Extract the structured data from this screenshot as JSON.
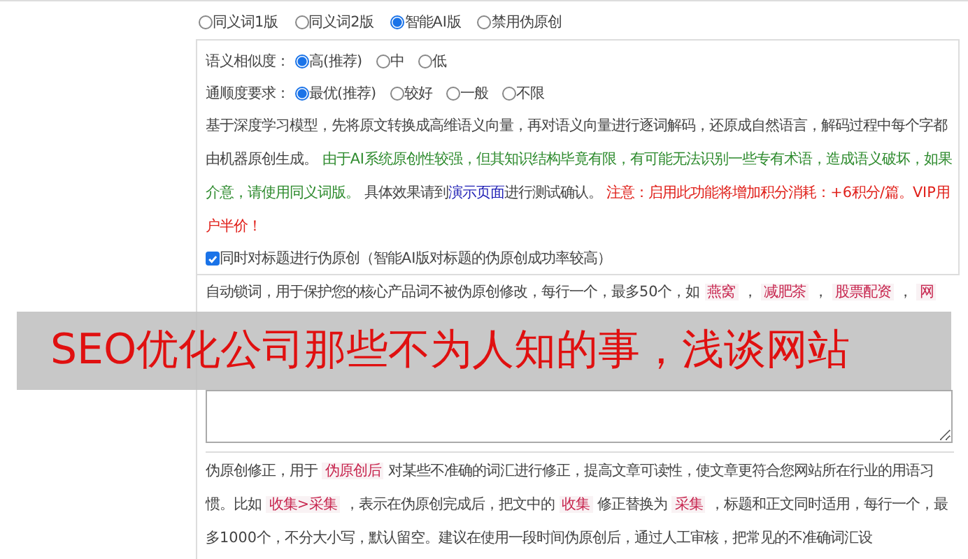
{
  "mode_options": [
    {
      "label": "同义词1版",
      "selected": false
    },
    {
      "label": "同义词2版",
      "selected": false
    },
    {
      "label": "智能AI版",
      "selected": true
    },
    {
      "label": "禁用伪原创",
      "selected": false
    }
  ],
  "similarity": {
    "label": "语义相似度：",
    "options": [
      {
        "label": "高(推荐)",
        "selected": true
      },
      {
        "label": "中",
        "selected": false
      },
      {
        "label": "低",
        "selected": false
      }
    ]
  },
  "fluency": {
    "label": "通顺度要求：",
    "options": [
      {
        "label": "最优(推荐)",
        "selected": true
      },
      {
        "label": "较好",
        "selected": false
      },
      {
        "label": "一般",
        "selected": false
      },
      {
        "label": "不限",
        "selected": false
      }
    ]
  },
  "description": [
    {
      "kind": "plain",
      "text": "基于深度学习模型，先将原文转换成高维语义向量，再对语义向量进行逐词解码，还原成自然语言，解码过程中每个字都由机器原创生成。 "
    },
    {
      "kind": "green",
      "text": "由于AI系统原创性较强，但其知识结构毕竟有限，有可能无法识别一些专有术语，造成语义破坏，如果介意，请使用同义词版。"
    },
    {
      "kind": "plain",
      "text": " 具体效果请到"
    },
    {
      "kind": "link",
      "text": "演示页面"
    },
    {
      "kind": "plain",
      "text": "进行测试确认。 "
    },
    {
      "kind": "red",
      "text": "注意：启用此功能将增加积分消耗：+6积分/篇。VIP用户半价！"
    }
  ],
  "title_checkbox": {
    "label": "同时对标题进行伪原创（智能AI版对标题的伪原创成功率较高）",
    "checked": true
  },
  "lock_words": [
    {
      "kind": "plain",
      "text": "自动锁词，用于保护您的核心产品词不被伪原创修改，每行一个，最多50个，如 "
    },
    {
      "kind": "tag",
      "text": "燕窝"
    },
    {
      "kind": "plain",
      "text": " ， "
    },
    {
      "kind": "tag",
      "text": "减肥茶"
    },
    {
      "kind": "plain",
      "text": " ， "
    },
    {
      "kind": "tag",
      "text": "股票配资"
    },
    {
      "kind": "plain",
      "text": " ， "
    },
    {
      "kind": "tag",
      "text": "网"
    }
  ],
  "correction": [
    {
      "kind": "plain",
      "text": "伪原创修正，用于 "
    },
    {
      "kind": "tag",
      "text": "伪原创后"
    },
    {
      "kind": "plain",
      "text": " 对某些不准确的词汇进行修正，提高文章可读性，使文章更符合您网站所在行业的用语习惯。比如 "
    },
    {
      "kind": "tag",
      "text": "收集>采集"
    },
    {
      "kind": "plain",
      "text": " ，表示在伪原创完成后，把文中的 "
    },
    {
      "kind": "tag",
      "text": "收集"
    },
    {
      "kind": "plain",
      "text": " 修正替换为 "
    },
    {
      "kind": "tag",
      "text": "采集"
    },
    {
      "kind": "plain",
      "text": " ，标题和正文同时适用，每行一个，最多1000个，不分大小写，默认留空。建议在使用一段时间伪原创后，通过人工审核，把常见的不准确词汇设"
    }
  ],
  "banner": {
    "text": "SEO优化公司那些不为人知的事，浅谈网站"
  }
}
